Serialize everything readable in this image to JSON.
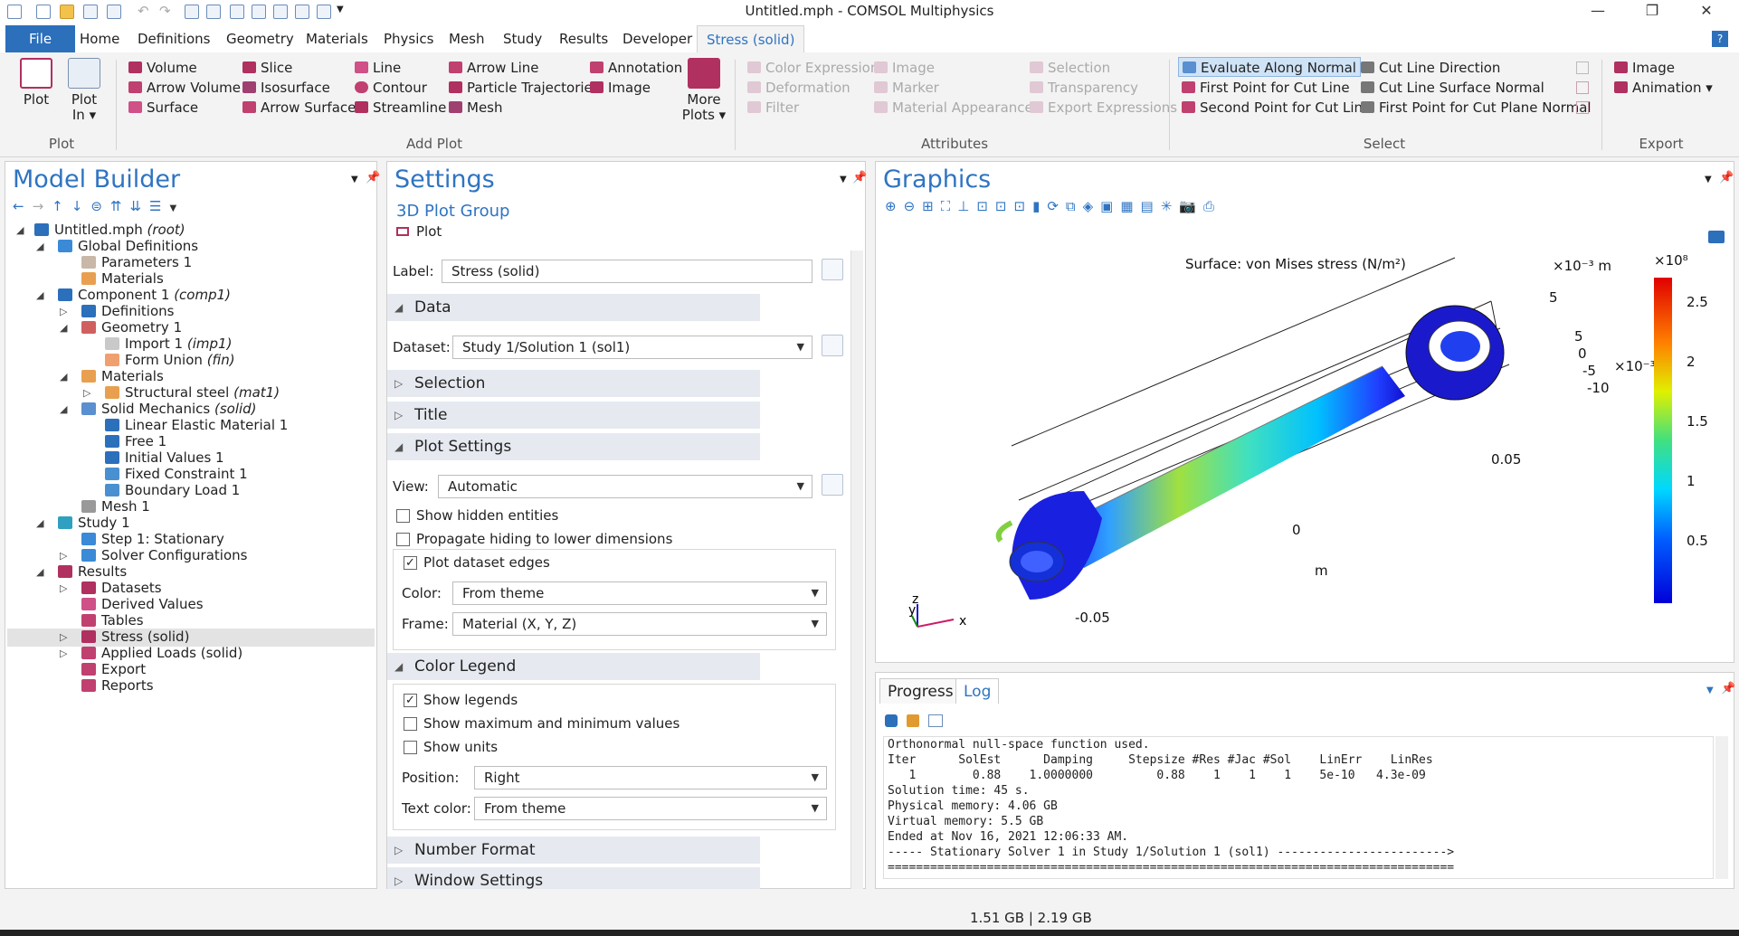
{
  "window": {
    "title": "Untitled.mph - COMSOL Multiphysics",
    "minimize": "—",
    "restore": "❐",
    "close": "✕"
  },
  "tabs": [
    "File",
    "Home",
    "Definitions",
    "Geometry",
    "Materials",
    "Physics",
    "Mesh",
    "Study",
    "Results",
    "Developer",
    "Stress (solid)"
  ],
  "ribbon": {
    "plot_label": "Plot",
    "plot_in_label": "Plot",
    "plot_in_label2": "In ▾",
    "group_plot": "Plot",
    "group_add_plot": "Add Plot",
    "group_attributes": "Attributes",
    "group_select": "Select",
    "group_export": "Export",
    "volume": "Volume",
    "arrow_volume": "Arrow Volume",
    "surface": "Surface",
    "slice": "Slice",
    "isosurface": "Isosurface",
    "arrow_surface": "Arrow Surface",
    "line": "Line",
    "contour": "Contour",
    "streamline": "Streamline",
    "arrow_line": "Arrow Line",
    "particle_trajectories": "Particle Trajectories",
    "mesh": "Mesh",
    "annotation": "Annotation",
    "image": "Image",
    "more_plots": "More",
    "more_plots2": "Plots ▾",
    "color_expression": "Color Expression",
    "deformation": "Deformation",
    "filter": "Filter",
    "image_attr": "Image",
    "marker": "Marker",
    "material_appearance": "Material Appearance",
    "selection": "Selection",
    "transparency": "Transparency",
    "export_expressions": "Export Expressions",
    "evaluate_along_normal": "Evaluate Along Normal",
    "first_point_cut_line": "First Point for Cut Line",
    "second_point_cut_line": "Second Point for Cut Line",
    "cut_line_direction": "Cut Line Direction",
    "cut_line_surface_normal": "Cut Line Surface Normal",
    "first_point_cut_plane_normal": "First Point for Cut Plane Normal",
    "export_image": "Image",
    "export_animation": "Animation ▾"
  },
  "model_builder": {
    "title": "Model Builder",
    "tree": [
      {
        "label": "Untitled.mph",
        "italic": "(root)"
      },
      {
        "label": "Global Definitions",
        "italic": ""
      },
      {
        "label": "Parameters 1",
        "italic": ""
      },
      {
        "label": "Materials",
        "italic": ""
      },
      {
        "label": "Component 1",
        "italic": "(comp1)"
      },
      {
        "label": "Definitions",
        "italic": ""
      },
      {
        "label": "Geometry 1",
        "italic": ""
      },
      {
        "label": "Import 1",
        "italic": "(imp1)"
      },
      {
        "label": "Form Union",
        "italic": "(fin)"
      },
      {
        "label": "Materials",
        "italic": ""
      },
      {
        "label": "Structural steel",
        "italic": "(mat1)"
      },
      {
        "label": "Solid Mechanics",
        "italic": "(solid)"
      },
      {
        "label": "Linear Elastic Material 1",
        "italic": ""
      },
      {
        "label": "Free 1",
        "italic": ""
      },
      {
        "label": "Initial Values 1",
        "italic": ""
      },
      {
        "label": "Fixed Constraint 1",
        "italic": ""
      },
      {
        "label": "Boundary Load 1",
        "italic": ""
      },
      {
        "label": "Mesh 1",
        "italic": ""
      },
      {
        "label": "Study 1",
        "italic": ""
      },
      {
        "label": "Step 1: Stationary",
        "italic": ""
      },
      {
        "label": "Solver Configurations",
        "italic": ""
      },
      {
        "label": "Results",
        "italic": ""
      },
      {
        "label": "Datasets",
        "italic": ""
      },
      {
        "label": "Derived Values",
        "italic": ""
      },
      {
        "label": "Tables",
        "italic": ""
      },
      {
        "label": "Stress (solid)",
        "italic": ""
      },
      {
        "label": "Applied Loads (solid)",
        "italic": ""
      },
      {
        "label": "Export",
        "italic": ""
      },
      {
        "label": "Reports",
        "italic": ""
      }
    ]
  },
  "settings": {
    "title": "Settings",
    "subtitle": "3D Plot Group",
    "plot_button": "Plot",
    "label_caption": "Label:",
    "label_value": "Stress (solid)",
    "data_section": "Data",
    "dataset_caption": "Dataset:",
    "dataset_value": "Study 1/Solution 1 (sol1)",
    "selection_section": "Selection",
    "title_section": "Title",
    "plot_settings_section": "Plot Settings",
    "view_caption": "View:",
    "view_value": "Automatic",
    "show_hidden": "Show hidden entities",
    "propagate_hiding": "Propagate hiding to lower dimensions",
    "plot_dataset_edges": "Plot dataset edges",
    "color_caption": "Color:",
    "color_value": "From theme",
    "frame_caption": "Frame:",
    "frame_value": "Material  (X, Y, Z)",
    "color_legend_section": "Color Legend",
    "show_legends": "Show legends",
    "show_max_min": "Show maximum and minimum values",
    "show_units": "Show units",
    "position_caption": "Position:",
    "position_value": "Right",
    "text_color_caption": "Text color:",
    "text_color_value": "From theme",
    "number_format_section": "Number Format",
    "window_settings_section": "Window Settings"
  },
  "graphics": {
    "title": "Graphics",
    "plot_title": "Surface: von Mises stress (N/m²)",
    "scale_top": "×10⁻³ m",
    "scale_right": "×10⁻³",
    "legend_exp": "×10⁸",
    "legend_ticks": [
      "2.5",
      "2",
      "1.5",
      "1",
      "0.5"
    ],
    "axis_numbers": [
      "5",
      "5",
      "0",
      "-5",
      "-10",
      "0.05",
      "0",
      "-0.05"
    ],
    "axis_unit": "m",
    "axis_z": "z",
    "axis_y": "y",
    "axis_x": "x"
  },
  "log_panel": {
    "tab_progress": "Progress",
    "tab_log": "Log",
    "lines": [
      "Orthonormal null-space function used.",
      "Iter      SolEst      Damping     Stepsize #Res #Jac #Sol    LinErr    LinRes",
      "   1        0.88    1.0000000         0.88    1    1    1    5e-10   4.3e-09",
      "Solution time: 45 s.",
      "Physical memory: 4.06 GB",
      "Virtual memory: 5.5 GB",
      "Ended at Nov 16, 2021 12:06:33 AM.",
      "----- Stationary Solver 1 in Study 1/Solution 1 (sol1) ------------------------>",
      "================================================================================"
    ]
  },
  "status_bar": {
    "memory": "1.51 GB | 2.19 GB"
  },
  "colors": {
    "accent": "#2f74c2",
    "file_tab": "#2c6fbb",
    "selected_row": "#e3e3e3",
    "section_header": "#e6eaf0"
  }
}
